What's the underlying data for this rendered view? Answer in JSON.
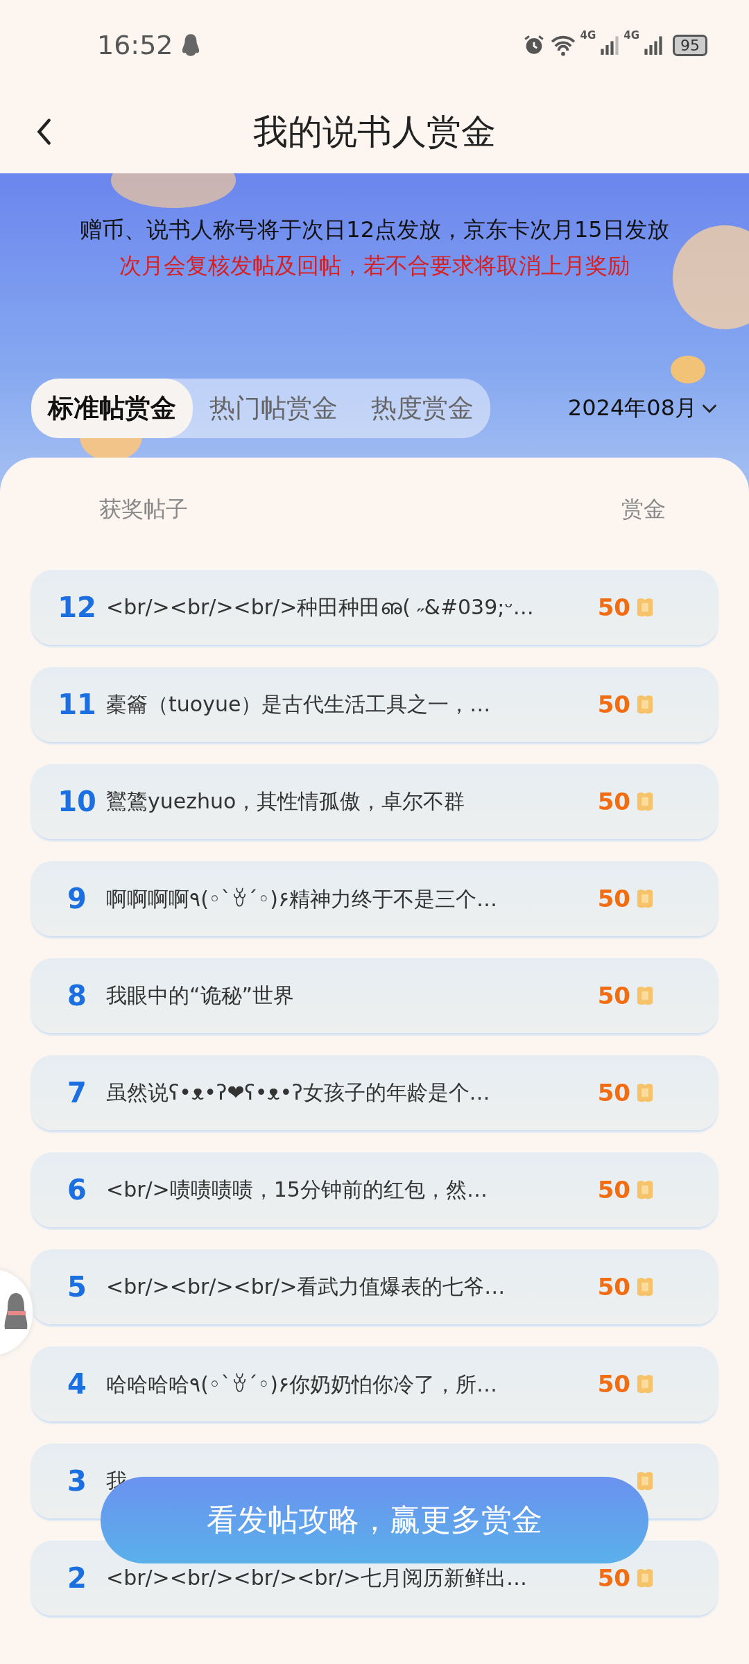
{
  "status_bar": {
    "time": "16:52",
    "network_1": "4G",
    "network_2": "4G",
    "battery": "95"
  },
  "header": {
    "title": "我的说书人赏金"
  },
  "notice": {
    "line": "赠币、说书人称号将于次日12点发放，京东卡次月15日发放",
    "warning": "次月会复核发帖及回帖，若不合要求将取消上月奖励"
  },
  "tabs": [
    {
      "label": "标准帖赏金",
      "selected": true
    },
    {
      "label": "热门帖赏金",
      "selected": false
    },
    {
      "label": "热度赏金",
      "selected": false
    }
  ],
  "month_picker": {
    "label": "2024年08月"
  },
  "table": {
    "columns": [
      "获奖帖子",
      "赏金"
    ],
    "rows": [
      {
        "rank": "12",
        "title": "<br/><br/><br/>种田种田ഌ( ˶&#039;ᵕ…",
        "reward": "50"
      },
      {
        "rank": "11",
        "title": "橐籥（tuoyue）是古代生活工具之一，…",
        "reward": "50"
      },
      {
        "rank": "10",
        "title": "鸑鷟yuezhuo，其性情孤傲，卓尔不群",
        "reward": "50"
      },
      {
        "rank": "9",
        "title": "啊啊啊啊٩(◦`ꈊ´◦)۶精神力终于不是三个…",
        "reward": "50"
      },
      {
        "rank": "8",
        "title": "我眼中的“诡秘”世界",
        "reward": "50"
      },
      {
        "rank": "7",
        "title": "虽然说ʕ•ᴥ•ʔ❤ʕ•ᴥ•ʔ女孩子的年龄是个…",
        "reward": "50"
      },
      {
        "rank": "6",
        "title": "<br/>啧啧啧啧，15分钟前的红包，然…",
        "reward": "50"
      },
      {
        "rank": "5",
        "title": "<br/><br/><br/>看武力值爆表的七爷…",
        "reward": "50"
      },
      {
        "rank": "4",
        "title": "哈哈哈哈٩(◦`ꈊ´◦)۶你奶奶怕你冷了，所…",
        "reward": "50"
      },
      {
        "rank": "3",
        "title": "我"
      },
      {
        "rank": "2",
        "title": "<br/><br/><br/><br/>七月阅历新鲜出…",
        "reward": "50"
      }
    ]
  },
  "cta_button": {
    "label": "看发帖攻略，赢更多赏金"
  }
}
